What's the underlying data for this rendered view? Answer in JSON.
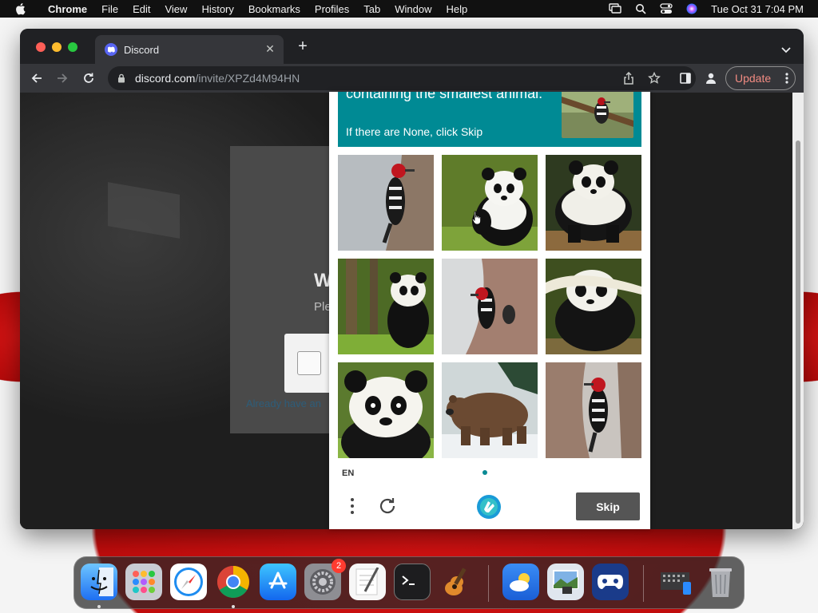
{
  "menubar": {
    "app": "Chrome",
    "items": [
      "File",
      "Edit",
      "View",
      "History",
      "Bookmarks",
      "Profiles",
      "Tab",
      "Window",
      "Help"
    ],
    "datetime": "Tue Oct 31  7:04 PM"
  },
  "browser": {
    "tab_title": "Discord",
    "url_domain": "discord.com",
    "url_path": "/invite/XPZd4M94HN",
    "update_label": "Update"
  },
  "page": {
    "title_partial": "W",
    "subtitle_partial": "Ple",
    "footer_link_partial": "Already have an"
  },
  "captcha": {
    "prompt": "containing the smallest animal.",
    "hint": "If there are None, click Skip",
    "language": "EN",
    "skip_label": "Skip",
    "tiles": [
      {
        "subject": "woodpecker"
      },
      {
        "subject": "panda"
      },
      {
        "subject": "panda"
      },
      {
        "subject": "panda"
      },
      {
        "subject": "woodpecker"
      },
      {
        "subject": "panda"
      },
      {
        "subject": "panda"
      },
      {
        "subject": "bear"
      },
      {
        "subject": "woodpecker"
      }
    ]
  },
  "dock": {
    "apps": [
      "finder",
      "launchpad",
      "safari",
      "chrome",
      "app-store",
      "system-settings",
      "textedit",
      "terminal",
      "garageband",
      "weather",
      "preview",
      "steam-link",
      "downloads",
      "trash"
    ],
    "settings_badge": "2"
  }
}
